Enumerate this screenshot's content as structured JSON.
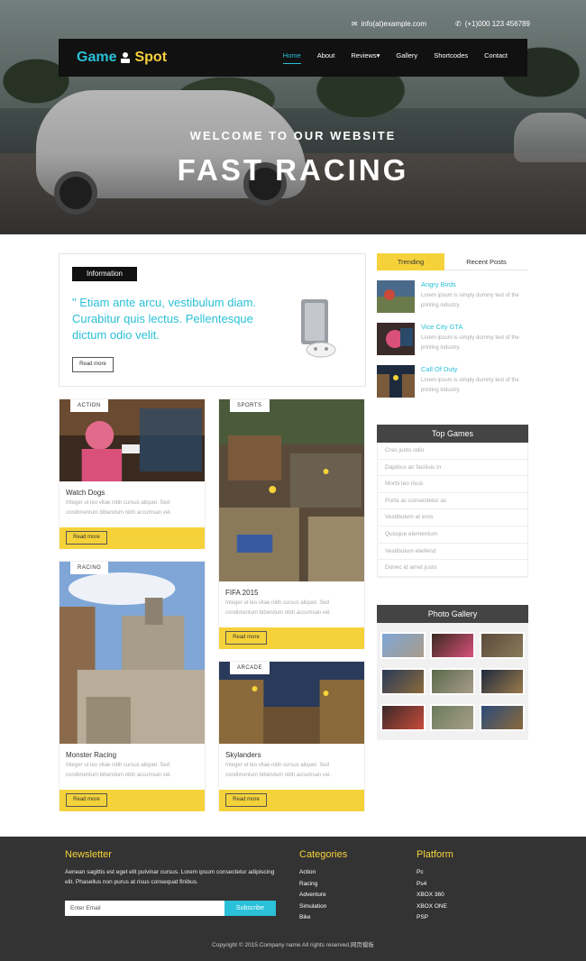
{
  "topbar": {
    "email": "info(at)example.com",
    "phone": "(+1)000 123 456789"
  },
  "brand": {
    "game": "Game",
    "spot": "Spot"
  },
  "nav": [
    "Home",
    "About",
    "Reviews▾",
    "Gallery",
    "Shortcodes",
    "Contact"
  ],
  "hero": {
    "subtitle": "WELCOME TO OUR WEBSITE",
    "title": "FAST RACING"
  },
  "info": {
    "tag": "Information",
    "quote": "\" Etiam ante arcu, vestibulum diam. Curabitur quis lectus. Pellentesque dictum odio velit.",
    "button": "Read more"
  },
  "cards": [
    {
      "label": "ACTION",
      "title": "Watch Dogs",
      "text": "Integer ut leo vitae nibh cursus aliquet. Sed condimentum bibendum nibh accumsan vel.",
      "button": "Read more"
    },
    {
      "label": "RACING",
      "title": "Monster Racing",
      "text": "Integer ut leo vitae nibh cursus aliquet. Sed condimentum bibendum nibh accumsan vel.",
      "button": "Read more"
    },
    {
      "label": "SPORTS",
      "title": "FIFA 2015",
      "text": "Integer ut leo vitae nibh cursus aliquet. Sed condimentum bibendum nibh accumsan vel.",
      "button": "Read more"
    },
    {
      "label": "ARCADE",
      "title": "Skylanders",
      "text": "Integer ut leo vitae nibh cursus aliquet. Sed condimentum bibendum nibh accumsan vel.",
      "button": "Read more"
    }
  ],
  "tabs": {
    "trending": "Trending",
    "recent": "Recent Posts"
  },
  "trending": [
    {
      "title": "Angry Birds",
      "text": "Lorem ipsum is simply dummy text of the printing industry."
    },
    {
      "title": "Vice City GTA",
      "text": "Lorem ipsum is simply dummy text of the printing industry."
    },
    {
      "title": "Call Of Duty",
      "text": "Lorem ipsum is simply dummy text of the printing industry."
    }
  ],
  "top_games": {
    "heading": "Top Games",
    "items": [
      "Cras justo odio",
      "Dapibus ac facilisis in",
      "Morbi leo risus",
      "Porta ac consectetur ac",
      "Vestibulum at eros",
      "Quisque elementum",
      "Vestibulum eleifend",
      "Donec id amet justo"
    ]
  },
  "gallery": {
    "heading": "Photo Gallery"
  },
  "footer": {
    "newsletter_heading": "Newsletter",
    "newsletter_text": "Aenean sagittis est eget elit pulvinar cursus. Lorem ipsum consectetur adipiscing elit. Phasellus non purus at risus consequat finibus.",
    "email_placeholder": "Enter Email",
    "subscribe": "Subscribe",
    "categories_heading": "Categories",
    "categories": [
      "Action",
      "Racing",
      "Adventure",
      "Simulation",
      "Bike"
    ],
    "platform_heading": "Platform",
    "platforms": [
      "Pc",
      "Ps4",
      "XBOX 360",
      "XBOX ONE",
      "PSP"
    ],
    "copyright": "Copyright © 2015.Company name All rights reserved.网页模板"
  },
  "colors": {
    "accent": "#2ac0d8",
    "yellow": "#f6d23a",
    "dark": "#111111",
    "footer": "#333333"
  }
}
